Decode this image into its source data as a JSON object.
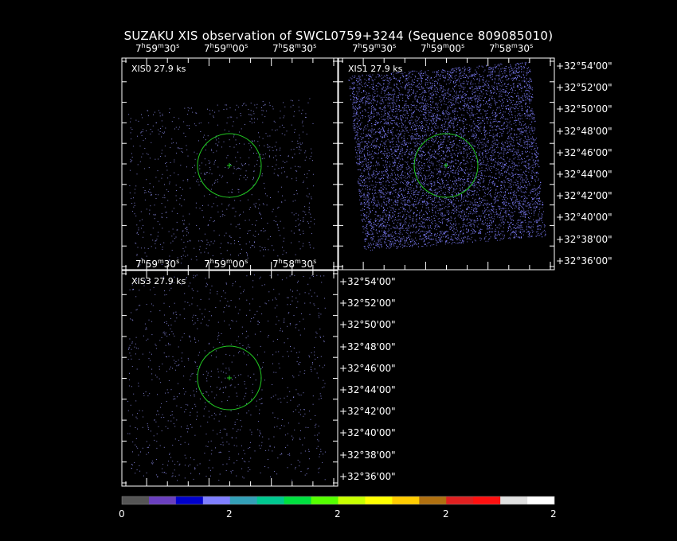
{
  "title": "SUZAKU XIS observation of SWCL0759+3244  (Sequence 809085010)",
  "ra_ticks": [
    {
      "h": "7",
      "m": "59",
      "s": "30"
    },
    {
      "h": "7",
      "m": "59",
      "s": "00"
    },
    {
      "h": "7",
      "m": "58",
      "s": "30"
    }
  ],
  "dec_ticks": [
    "+32°54'00\"",
    "+32°52'00\"",
    "+32°50'00\"",
    "+32°48'00\"",
    "+32°46'00\"",
    "+32°44'00\"",
    "+32°42'00\"",
    "+32°40'00\"",
    "+32°38'00\"",
    "+32°36'00\""
  ],
  "panels": [
    {
      "id": "xis0",
      "label": "XIS0 27.9 ks"
    },
    {
      "id": "xis1",
      "label": "XIS1 27.9 ks"
    },
    {
      "id": "xis3",
      "label": "XIS3 27.9 ks"
    }
  ],
  "colorbar": {
    "colors": [
      "#555555",
      "#6a3fbf",
      "#0000cc",
      "#7f7fff",
      "#33a0b8",
      "#00c890",
      "#00e040",
      "#55ff00",
      "#c8ff00",
      "#ffff00",
      "#ffcc00",
      "#b07010",
      "#e02020",
      "#ff1010",
      "#e0e0e0",
      "#ffffff"
    ],
    "tick_labels": [
      "0",
      "2",
      "2",
      "2",
      "2"
    ]
  },
  "colors": {
    "region": "#22cc22",
    "frame": "#ffffff",
    "events": "#8080ff"
  }
}
